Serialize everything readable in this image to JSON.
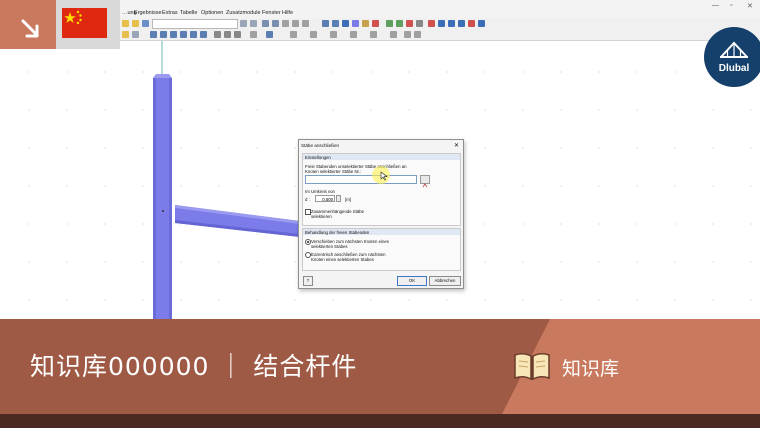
{
  "menu": {
    "items": [
      "…ung",
      "Ergebnisse",
      "Extras",
      "Tabelle",
      "Optionen",
      "Zusatzmodule",
      "Fenster",
      "Hilfe"
    ]
  },
  "dialog": {
    "title": "Stäbe anschließen",
    "close_glyph": "✕",
    "group1_header": "Einstellungen",
    "description_line1": "Freie Stabenden unselektierter Stäbe anschließen an",
    "description_line2": "Knoten selektierter Stäbe Nr.:",
    "members_field_value": "",
    "radius_label": "Im Umkreis von",
    "d_label": "d :",
    "d_value": "0.500",
    "d_unit": "[m]",
    "checkbox_line1": "Zusammenhängende Stäbe",
    "checkbox_line2": "selektieren",
    "checkbox_checked": false,
    "group2_header": "Behandlung der freien Stabenden",
    "radio1_line1": "Verschieben zum nächsten Knoten eines",
    "radio1_line2": "selektierten Stabes",
    "radio1_selected": true,
    "radio2_line1": "Exzentrisch anschließen zum nächsten",
    "radio2_line2": "Knoten eines selektierten Stabes",
    "radio2_selected": false,
    "ok_label": "OK",
    "cancel_label": "Abbrechen"
  },
  "banner": {
    "title": "知识库000000 ｜ 结合杆件",
    "right_label": "知识库"
  },
  "logo": {
    "text": "Dlubal"
  },
  "colors": {
    "accent_orange": "#c9795d",
    "banner_brown": "#9e5a45",
    "member_blue": "#7b7bea",
    "logo_blue": "#15406b",
    "flag_red": "#de2910",
    "flag_yellow": "#ffde00"
  },
  "icons": [
    "arrow-down-right-icon",
    "china-flag-icon",
    "book-icon",
    "bridge-logo-icon",
    "select-members-icon",
    "help-icon"
  ]
}
